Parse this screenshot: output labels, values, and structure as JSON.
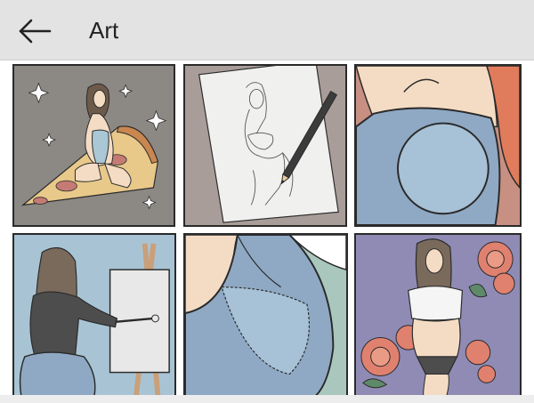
{
  "app_bar": {
    "title": "Art",
    "back_icon": "arrow-left-icon"
  },
  "gallery": {
    "tiles": [
      {
        "name": "tile-girl-on-pizza",
        "background": "#8c8884"
      },
      {
        "name": "tile-sketch-with-pencil",
        "background": "#a89d98"
      },
      {
        "name": "tile-jeans-closeup-orange",
        "background": "#b88b80"
      },
      {
        "name": "tile-girl-painting-easel",
        "background": "#a8c4d4"
      },
      {
        "name": "tile-jeans-pocket-green",
        "background": "#a9c7bd"
      },
      {
        "name": "tile-girl-with-roses",
        "background": "#8f8bb4"
      }
    ]
  },
  "colors": {
    "app_bar": "#e3e3e3",
    "denim": "#8fa9c4",
    "skin": "#f4dcc4",
    "outline": "#2a2a2a"
  }
}
